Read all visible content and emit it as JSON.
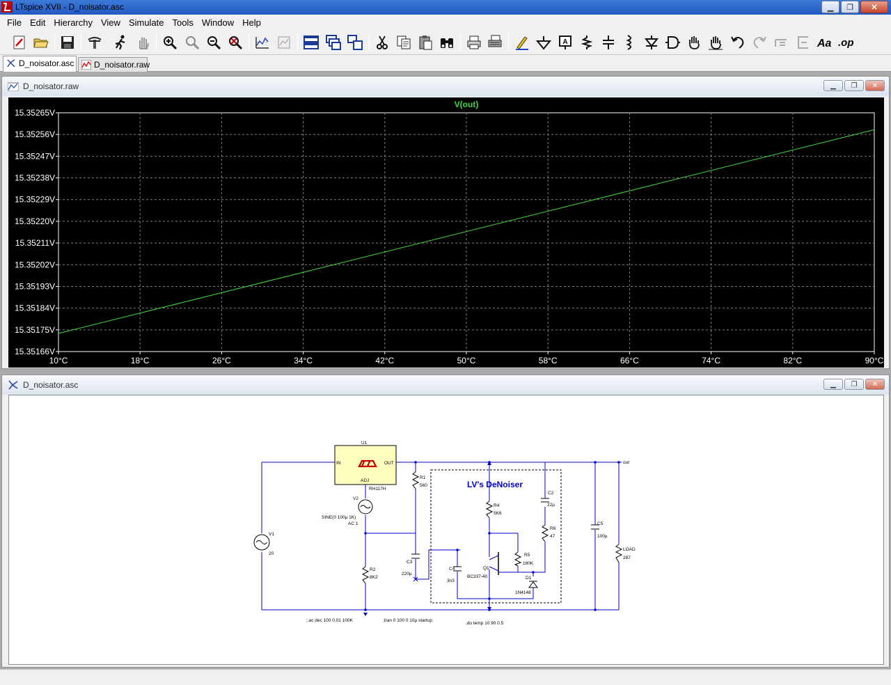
{
  "window": {
    "title": "LTspice XVII - D_noisator.asc"
  },
  "menu": [
    "File",
    "Edit",
    "Hierarchy",
    "View",
    "Simulate",
    "Tools",
    "Window",
    "Help"
  ],
  "toolbar": [
    "new-schematic",
    "open",
    "save",
    "control-panel",
    "run",
    "halt",
    "zoom-in",
    "zoom-pan",
    "zoom-out",
    "zoom-fit",
    "autorange",
    "waveform-settings",
    "tile-horizontal",
    "cascade",
    "tile-vertical",
    "cut",
    "copy",
    "paste",
    "find",
    "print",
    "print-setup",
    "draw-wire",
    "ground",
    "label-net",
    "component",
    "resistor",
    "capacitor",
    "inductor",
    "diode",
    "component-symbol",
    "move",
    "drag",
    "undo",
    "redo",
    "rotate",
    "mirror",
    "text",
    "spice-directive"
  ],
  "toolbar_extra_text": {
    "text_tool": "Aa",
    "op_tool": ".op"
  },
  "tabs": [
    {
      "label": "D_noisator.asc",
      "active": true
    },
    {
      "label": "D_noisator.raw",
      "active": false
    }
  ],
  "plot_window": {
    "title": "D_noisator.raw"
  },
  "schematic_window": {
    "title": "D_noisator.asc"
  },
  "chart_data": {
    "type": "line",
    "title": "V(out)",
    "series": [
      {
        "name": "V(out)",
        "color": "#3cdc3c",
        "x": [
          10,
          90
        ],
        "values": [
          15.351735,
          15.35258
        ]
      }
    ],
    "xlim": [
      10,
      90
    ],
    "ylim": [
      15.35166,
      15.35265
    ],
    "x_ticks": [
      "10°C",
      "18°C",
      "26°C",
      "34°C",
      "42°C",
      "50°C",
      "58°C",
      "66°C",
      "74°C",
      "82°C",
      "90°C"
    ],
    "y_ticks": [
      "15.35265V",
      "15.35256V",
      "15.35247V",
      "15.35238V",
      "15.35229V",
      "15.35220V",
      "15.35211V",
      "15.35202V",
      "15.35193V",
      "15.35184V",
      "15.35175V",
      "15.35166V"
    ],
    "grid": true,
    "background": "#000000",
    "axis_color": "#ffffff"
  },
  "schematic": {
    "wire_color": "#0000cc",
    "box_color": "#000000",
    "labels": {
      "u1": "U1",
      "u1_in": "IN",
      "u1_out": "OUT",
      "u1_adj": "ADJ",
      "u1_part": "RH117H",
      "v1": "V1",
      "v1_val": "20",
      "v2": "V2",
      "v2_val1": "SINE(0 100µ 1K)",
      "v2_val2": "AC 1",
      "r1": "R1",
      "r1_val": "560",
      "r2": "R2",
      "r2_val": "8K2",
      "c3": "C3",
      "c3_val": "220µ",
      "c4": "C4",
      "c4_val": "3n3",
      "r4": "R4",
      "r4_val": "5K6",
      "r5": "R5",
      "r5_val": "180K",
      "q1": "Q1",
      "q1_val": "BC337-40",
      "d1": "D1",
      "d1_val": "1N4148",
      "c2": "C2",
      "c2_val": "22µ",
      "r6": "R6",
      "r6_val": "47",
      "c5": "C5",
      "c5_val": "100µ",
      "load": "LOAD",
      "load_val": "287",
      "out": "out",
      "title": "LV's DeNoiser",
      "directive_ac": ";.ac dec 100 0.01 100K",
      "directive_tran": ";tran 0 100 0 10µ startup",
      "directive_step": ".do temp 10 90 0.5"
    }
  }
}
